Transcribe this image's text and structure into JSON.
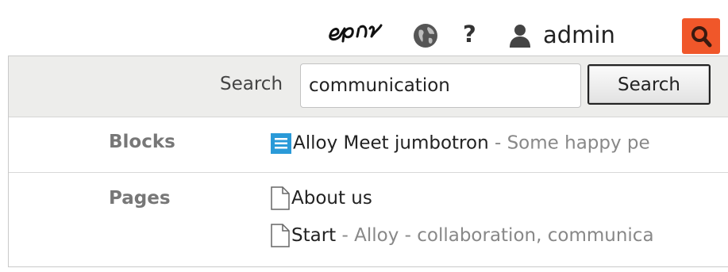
{
  "topbar": {
    "logo_text": "epi",
    "help_label": "?",
    "username": "admin",
    "accent": "#f0572a"
  },
  "search": {
    "label": "Search",
    "query": "communication",
    "button_label": "Search"
  },
  "groups": {
    "blocks": {
      "label": "Blocks",
      "results": [
        {
          "icon": "block-icon",
          "title": "Alloy Meet jumbotron",
          "separator": " - ",
          "description": "Some happy pe"
        }
      ]
    },
    "pages": {
      "label": "Pages",
      "results": [
        {
          "icon": "page-icon",
          "title": "About us",
          "separator": "",
          "description": ""
        },
        {
          "icon": "page-icon",
          "title": "Start",
          "separator": " - ",
          "description": "Alloy - collaboration, communica"
        }
      ]
    }
  }
}
